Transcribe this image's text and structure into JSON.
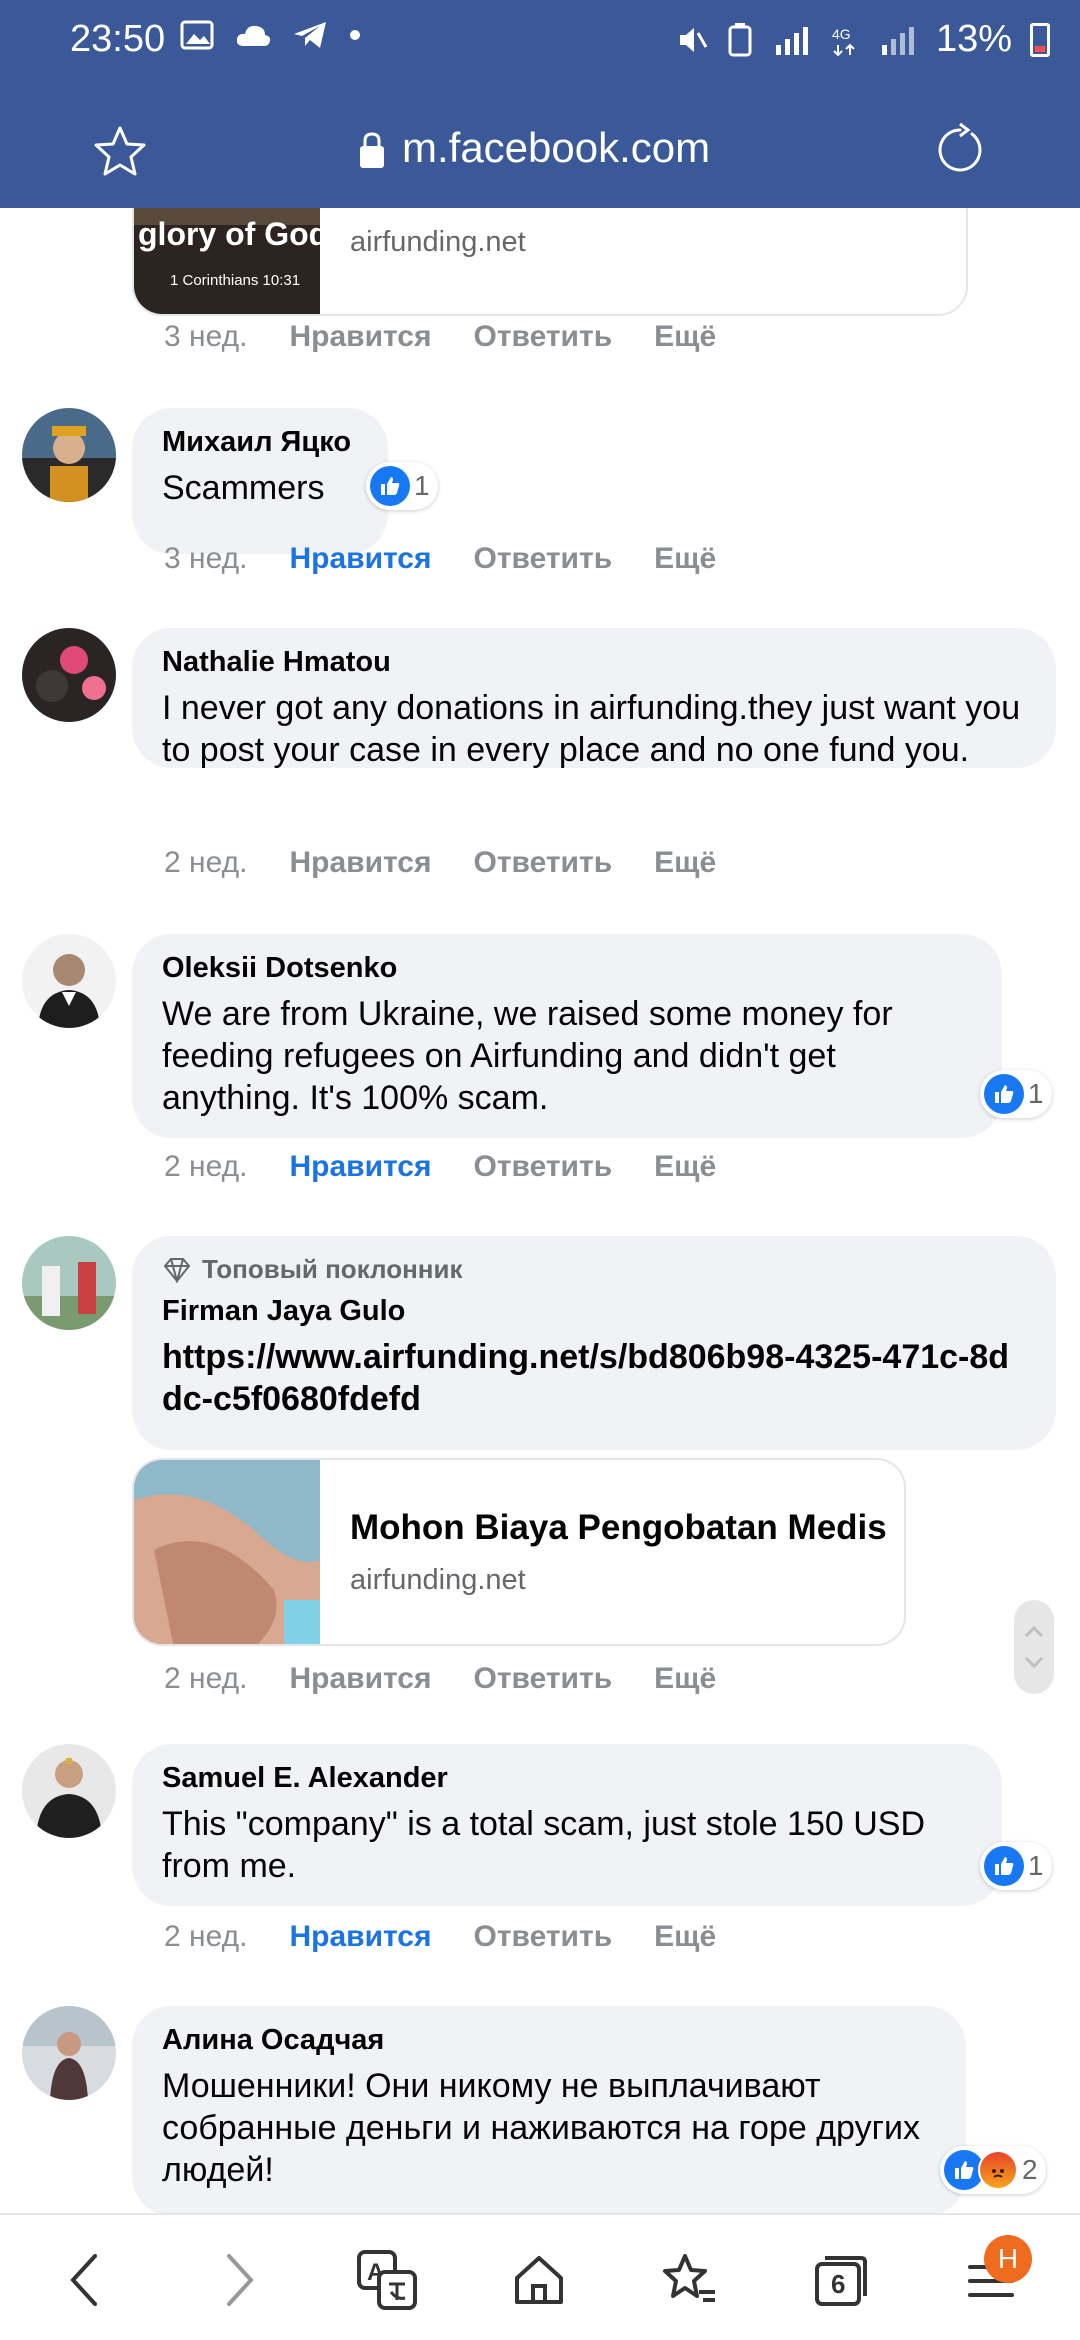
{
  "status_bar": {
    "time": "23:50",
    "battery": "13%"
  },
  "browser": {
    "url": "m.facebook.com"
  },
  "top_preview": {
    "image_text": "glory of God",
    "image_caption": "1 Corinthians 10:31",
    "domain": "airfunding.net"
  },
  "comments": [
    {
      "time": "3 нед.",
      "like": "Нравится",
      "reply": "Ответить",
      "more": "Ещё"
    },
    {
      "name": "Михаил Яцко",
      "text": "Scammers",
      "reactions": "1",
      "time": "3 нед.",
      "like": "Нравится",
      "reply": "Ответить",
      "more": "Ещё"
    },
    {
      "name": "Nathalie Hmatou",
      "text": "I never got any donations in airfunding.they just want you to post your case in every place and no one fund you.",
      "time": "2 нед.",
      "like": "Нравится",
      "reply": "Ответить",
      "more": "Ещё"
    },
    {
      "name": "Oleksii Dotsenko",
      "text": "We are from Ukraine, we raised some money for feeding refugees on Airfunding and didn't get anything. It's 100% scam.",
      "reactions": "1",
      "time": "2 нед.",
      "like": "Нравится",
      "reply": "Ответить",
      "more": "Ещё"
    },
    {
      "badge": "Топовый поклонник",
      "name": "Firman Jaya Gulo",
      "link": "https://www.airfunding.net/s/bd806b98-4325-471c-8ddc-c5f0680fdefd",
      "preview_title": "Mohon Biaya Pengobatan Medis",
      "preview_domain": "airfunding.net",
      "time": "2 нед.",
      "like": "Нравится",
      "reply": "Ответить",
      "more": "Ещё"
    },
    {
      "name": "Samuel E. Alexander",
      "text": "This \"company\" is a total scam, just stole 150 USD from me.",
      "reactions": "1",
      "time": "2 нед.",
      "like": "Нравится",
      "reply": "Ответить",
      "more": "Ещё"
    },
    {
      "name": "Алина Осадчая",
      "text": "Мошенники! Они никому не выплачивают собранные деньги и наживаются на горе других людей!",
      "reactions": "2"
    }
  ],
  "bottom_nav": {
    "tabs_count": "6",
    "profile_initial": "H"
  },
  "colors": {
    "header": "#3b5998",
    "like_blue": "#1b74e4",
    "bubble": "#f0f2f5"
  }
}
